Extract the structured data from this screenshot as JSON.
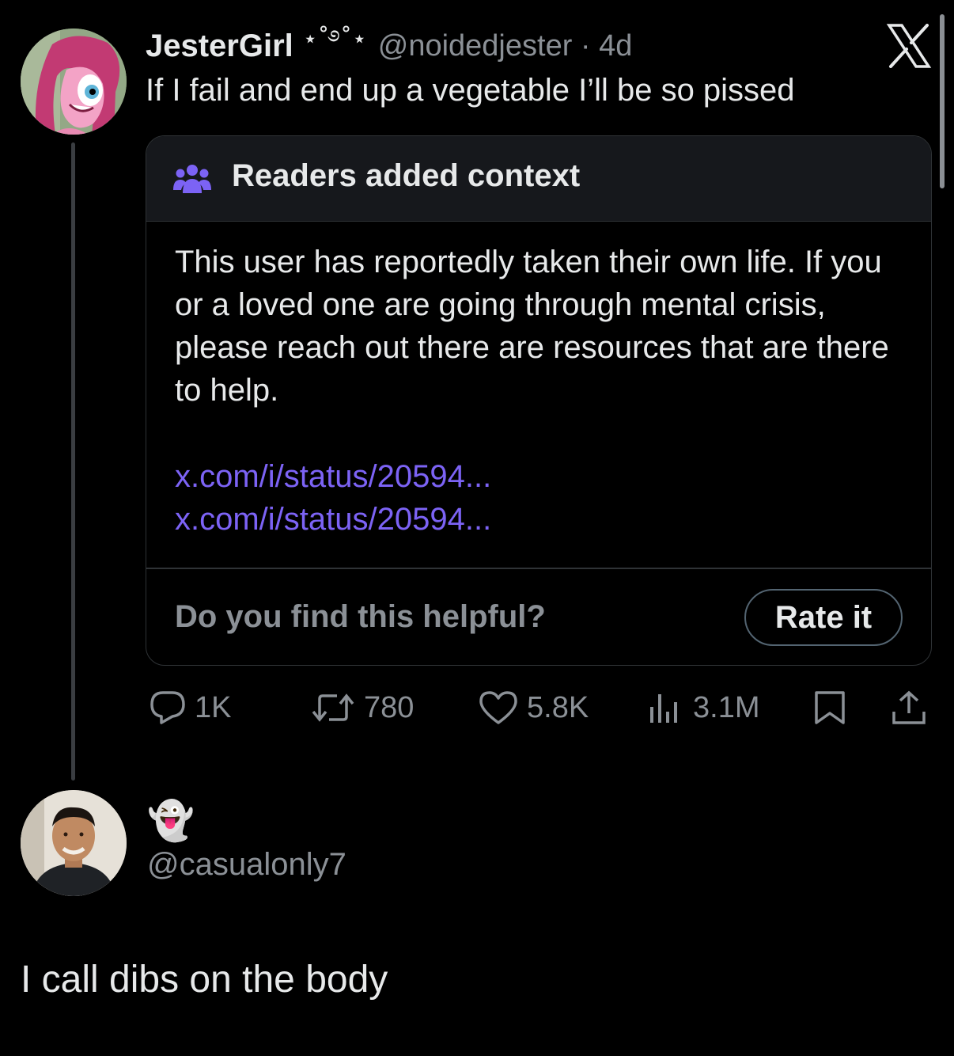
{
  "tweet": {
    "display_name": "JesterGirl",
    "name_decoration": "⋆˚࿔˚⋆",
    "handle_time": "@noidedjester · 4d",
    "text": "If I fail and end up a vegetable I’ll be so pissed"
  },
  "note": {
    "title": "Readers added context",
    "body": "This user has reportedly taken their own life. If you or a loved one are going through mental crisis, please reach out there are resources that are there to help.",
    "links": [
      "x.com/i/status/20594...",
      "x.com/i/status/20594..."
    ],
    "helpful_prompt": "Do you find this helpful?",
    "rate_label": "Rate it"
  },
  "actions": {
    "replies": "1K",
    "reposts": "780",
    "likes": "5.8K",
    "views": "3.1M"
  },
  "reply": {
    "display_name": "👻",
    "handle": "@casualonly7",
    "text": "I call dibs on the body"
  },
  "colors": {
    "background": "#000000",
    "text": "#e7e9ea",
    "muted": "#8b9096",
    "note_accent": "#7c63f5"
  }
}
